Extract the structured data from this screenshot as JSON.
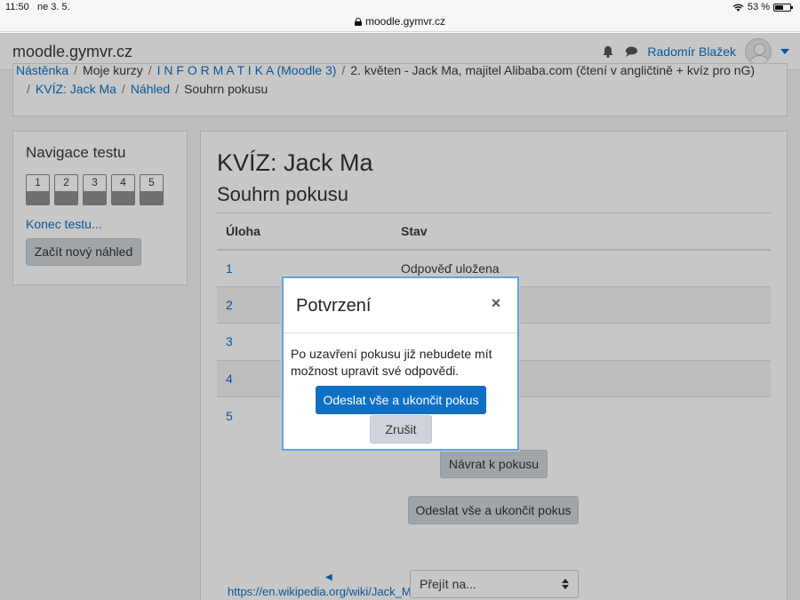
{
  "status_bar": {
    "time": "11:50",
    "date": "ne 3. 5.",
    "battery": "53 %"
  },
  "browser": {
    "url": "moodle.gymvr.cz"
  },
  "navbar": {
    "brand": "moodle.gymvr.cz",
    "user_name": "Radomír Blažek"
  },
  "breadcrumb": {
    "line1": [
      "Nástěnka",
      "Moje kurzy",
      "I N F O R M A T I K A (Moodle 3)",
      "2. květen - Jack Ma, majitel Alibaba.com (čtení v angličtině + kvíz pro nG)"
    ],
    "line2": [
      "KVÍZ: Jack Ma",
      "Náhled",
      "Souhrn pokusu"
    ]
  },
  "quiz_nav": {
    "title": "Navigace testu",
    "questions": [
      "1",
      "2",
      "3",
      "4",
      "5"
    ],
    "end_link": "Konec testu...",
    "new_preview_button": "Začít nový náhled"
  },
  "main": {
    "title": "KVÍZ: Jack Ma",
    "subtitle": "Souhrn pokusu",
    "table": {
      "headers": [
        "Úloha",
        "Stav"
      ],
      "rows": [
        {
          "question": "1",
          "status": "Odpověď uložena"
        },
        {
          "question": "2",
          "status": ""
        },
        {
          "question": "3",
          "status": ""
        },
        {
          "question": "4",
          "status": ""
        },
        {
          "question": "5",
          "status": ""
        }
      ]
    },
    "return_button": "Návrat k pokusu",
    "submit_button": "Odeslat vše a ukončit pokus",
    "prev_link": "https://en.wikipedia.org/wiki/Jack_Ma",
    "jump_select": "Přejít na..."
  },
  "dialog": {
    "title": "Potvrzení",
    "close_symbol": "×",
    "body": "Po uzavření pokusu již nebudete mít možnost upravit své odpovědi.",
    "confirm_button": "Odeslat vše a ukončit pokus",
    "cancel_button": "Zrušit"
  },
  "colors": {
    "link": "#0f6fc5",
    "primary": "#0f6fc5",
    "grey_button": "#ced4da"
  }
}
